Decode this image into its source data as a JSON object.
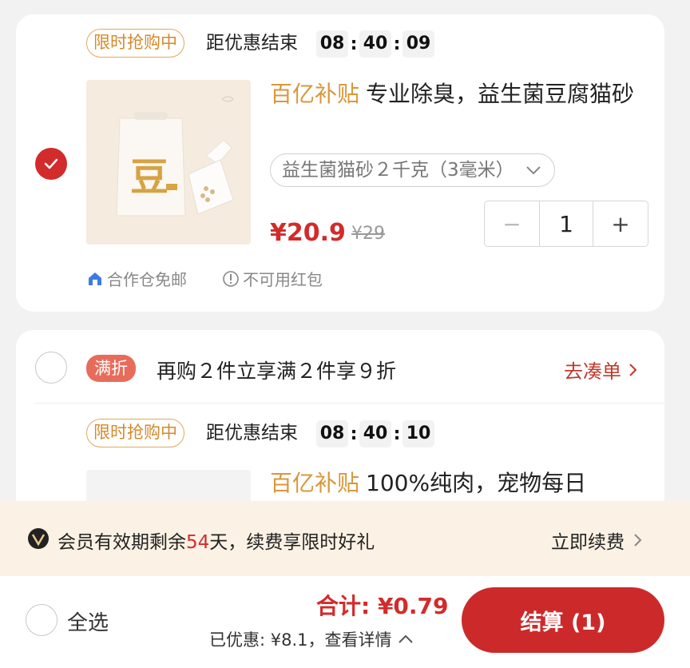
{
  "cart": {
    "items": [
      {
        "flash_badge": "限时抢购中",
        "ends_label": "距优惠结束",
        "timer": [
          "08",
          "40",
          "09"
        ],
        "subsidy": "百亿补贴",
        "title": "专业除臭，益生菌豆腐猫砂",
        "sku": "益生菌猫砂２千克（3毫米）",
        "price": "¥20.9",
        "original_price": "¥29",
        "quantity": "1",
        "minus": "−",
        "plus": "+",
        "tag_shipping": "合作仓免邮",
        "tag_no_redpacket": "不可用红包",
        "selected": true,
        "image_glyph": "豆"
      }
    ],
    "promo": {
      "badge": "满折",
      "text": "再购２件立享满２件享９折",
      "link": "去凑单"
    },
    "item2": {
      "flash_badge": "限时抢购中",
      "ends_label": "距优惠结束",
      "timer": [
        "08",
        "40",
        "10"
      ],
      "subsidy": "百亿补贴",
      "title": "100%纯肉，宠物每日"
    }
  },
  "member": {
    "prefix": "会员有效期剩余",
    "days": "54",
    "suffix": "天，续费享限时好礼",
    "renew": "立即续费"
  },
  "footer": {
    "select_all": "全选",
    "total": "合计: ¥0.79",
    "saved": "已优惠: ¥8.1，查看详情",
    "checkout": "结算 (1)"
  },
  "colors": {
    "accent_red": "#d22b2b",
    "subsidy_gold": "#d9973a",
    "member_bg": "#fbf1e4"
  }
}
